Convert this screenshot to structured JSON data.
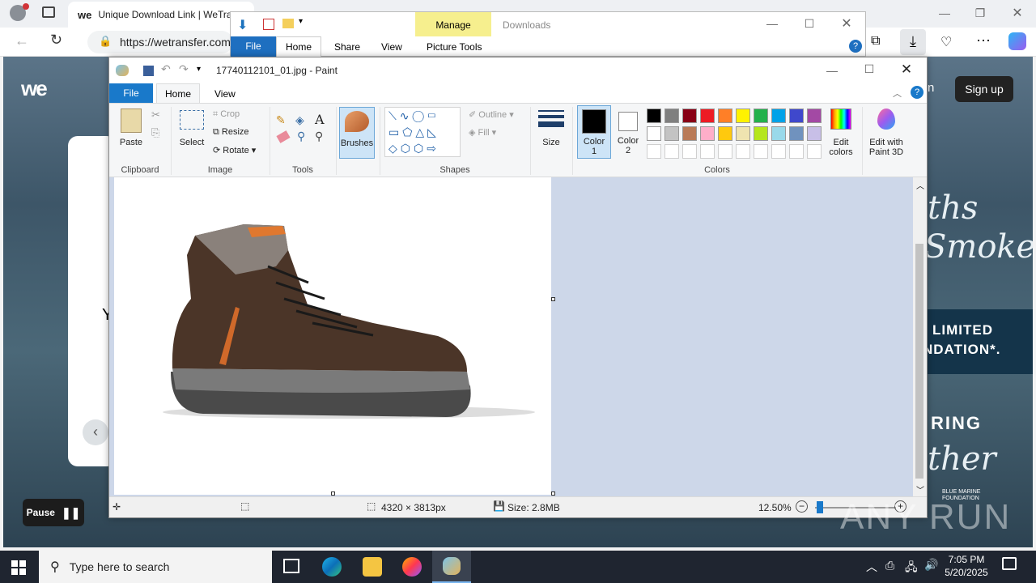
{
  "browser": {
    "tab_title": "Unique Download Link | WeTrans",
    "url": "https://wetransfer.com"
  },
  "webpage": {
    "logo": "we",
    "signup": "Sign up",
    "partial_login": "n",
    "pause_label": "Pause",
    "partial_letter": "Y",
    "promo_lines": [
      "ths",
      "Smoke",
      "LIMITED",
      "NDATION*.",
      "RING",
      "ther"
    ],
    "foundation": "BLUE MARINE FOUNDATION"
  },
  "explorer": {
    "manage": "Manage",
    "downloads": "Downloads",
    "tabs": [
      "File",
      "Home",
      "Share",
      "View",
      "Picture Tools"
    ]
  },
  "paint": {
    "title": "17740112101_01.jpg - Paint",
    "tabs": [
      "File",
      "Home",
      "View"
    ],
    "clipboard": {
      "paste": "Paste",
      "label": "Clipboard"
    },
    "image": {
      "select": "Select",
      "crop": "Crop",
      "resize": "Resize",
      "rotate": "Rotate",
      "label": "Image"
    },
    "tools": {
      "label": "Tools"
    },
    "brushes": "Brushes",
    "shapes": {
      "outline": "Outline",
      "fill": "Fill",
      "label": "Shapes"
    },
    "size": "Size",
    "color1": "Color\n1",
    "color2": "Color\n2",
    "colors_label": "Colors",
    "edit_colors": "Edit\ncolors",
    "edit_paint3d": "Edit with\nPaint 3D",
    "palette_row1": [
      "#000000",
      "#7f7f7f",
      "#880015",
      "#ed1c24",
      "#ff7f27",
      "#fff200",
      "#22b14c",
      "#00a2e8",
      "#3f48cc",
      "#a349a4"
    ],
    "palette_row2": [
      "#ffffff",
      "#c3c3c3",
      "#b97a57",
      "#ffaec9",
      "#ffc90e",
      "#efe4b0",
      "#b5e61d",
      "#99d9ea",
      "#7092be",
      "#c8bfe7"
    ],
    "status": {
      "dimensions": "4320 × 3813px",
      "size": "Size: 2.8MB",
      "zoom": "12.50%"
    }
  },
  "taskbar": {
    "search_placeholder": "Type here to search",
    "time": "7:05 PM",
    "date": "5/20/2025"
  },
  "watermark": "ANY RUN"
}
